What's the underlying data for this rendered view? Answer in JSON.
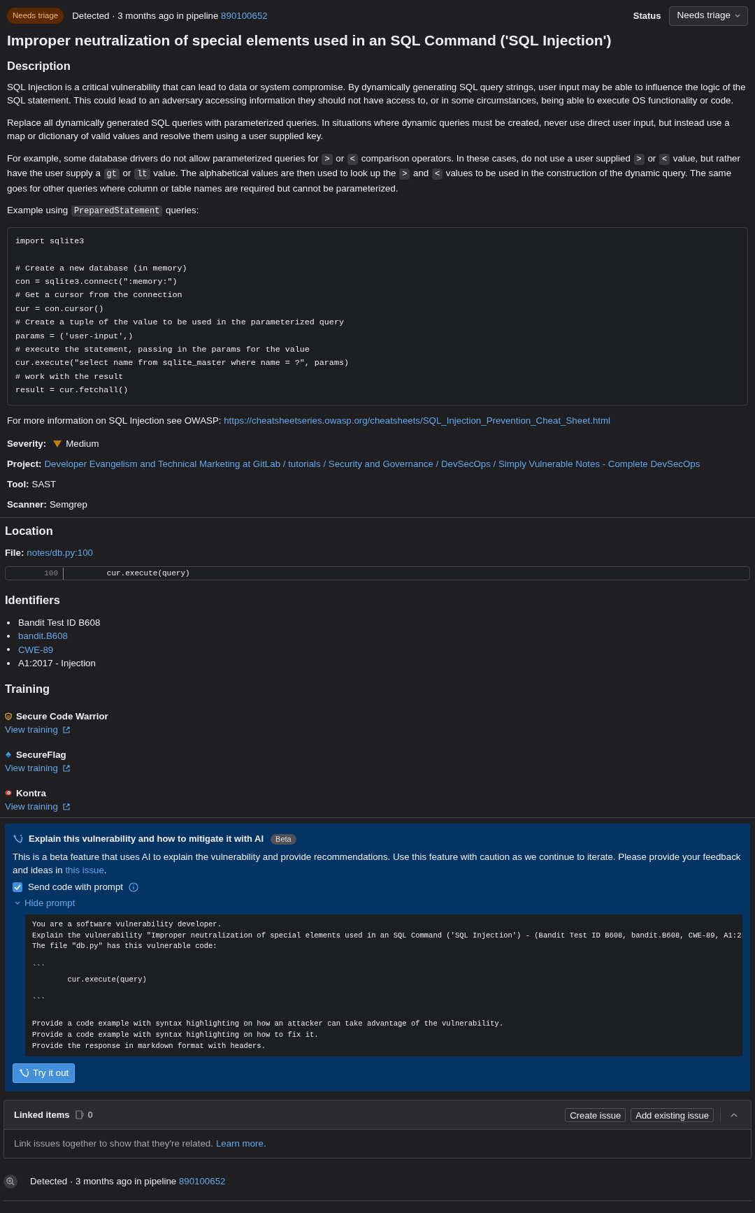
{
  "header": {
    "badge": "Needs triage",
    "detected": "Detected · 3 months ago in pipeline",
    "pipeline": "890100652",
    "status_label": "Status",
    "status_value": "Needs triage"
  },
  "title": "Improper neutralization of special elements used in an SQL Command ('SQL Injection')",
  "description": {
    "heading": "Description",
    "paragraphs": [
      [
        {
          "kind": "text",
          "text": "SQL Injection is a critical vulnerability that can lead to data or system compromise. By dynamically generating SQL query strings, user input may be able to influence the logic of the SQL statement. This could lead to an adversary accessing information they should not have access to, or in some circumstances, being able to execute OS functionality or code."
        }
      ],
      [
        {
          "kind": "text",
          "text": "Replace all dynamically generated SQL queries with parameterized queries. In situations where dynamic queries must be created, never use direct user input, but instead use a map or dictionary of valid values and resolve them using a user supplied key."
        }
      ],
      [
        {
          "kind": "text",
          "text": "For example, some database drivers do not allow parameterized queries for "
        },
        {
          "kind": "code",
          "text": ">"
        },
        {
          "kind": "text",
          "text": " or "
        },
        {
          "kind": "code",
          "text": "<"
        },
        {
          "kind": "text",
          "text": " comparison operators. In these cases, do not use a user supplied "
        },
        {
          "kind": "code",
          "text": ">"
        },
        {
          "kind": "text",
          "text": " or "
        },
        {
          "kind": "code",
          "text": "<"
        },
        {
          "kind": "text",
          "text": " value, but rather have the user supply a "
        },
        {
          "kind": "code",
          "text": "gt"
        },
        {
          "kind": "text",
          "text": " or "
        },
        {
          "kind": "code",
          "text": "lt"
        },
        {
          "kind": "text",
          "text": " value. The alphabetical values are then used to look up the "
        },
        {
          "kind": "code",
          "text": ">"
        },
        {
          "kind": "text",
          "text": " and "
        },
        {
          "kind": "code",
          "text": "<"
        },
        {
          "kind": "text",
          "text": " values to be used in the construction of the dynamic query. The same goes for other queries where column or table names are required but cannot be parameterized."
        }
      ],
      [
        {
          "kind": "text",
          "text": "Example using "
        },
        {
          "kind": "code",
          "text": "PreparedStatement"
        },
        {
          "kind": "text",
          "text": " queries:"
        }
      ]
    ],
    "code": "import sqlite3\n\n# Create a new database (in memory)\ncon = sqlite3.connect(\":memory:\")\n# Get a cursor from the connection\ncur = con.cursor()\n# Create a tuple of the value to be used in the parameterized query\nparams = ('user-input',)\n# execute the statement, passing in the params for the value\ncur.execute(\"select name from sqlite_master where name = ?\", params)\n# work with the result\nresult = cur.fetchall()",
    "more_info": [
      {
        "kind": "text",
        "text": "For more information on SQL Injection see OWASP: "
      },
      {
        "kind": "link",
        "text": "https://cheatsheetseries.owasp.org/cheatsheets/SQL_Injection_Prevention_Cheat_Sheet.html"
      }
    ]
  },
  "details": [
    {
      "label": "Severity:",
      "value": "Medium",
      "kind": "severity"
    },
    {
      "label": "Project:",
      "value": "Developer Evangelism and Technical Marketing at GitLab / tutorials / Security and Governance / DevSecOps / Simply Vulnerable Notes - Complete DevSecOps",
      "kind": "link"
    },
    {
      "label": "Tool:",
      "value": "SAST",
      "kind": "text"
    },
    {
      "label": "Scanner:",
      "value": "Semgrep",
      "kind": "text"
    }
  ],
  "location": {
    "heading": "Location",
    "file_label": "File:",
    "file_link": "notes/db.py:100",
    "line_number": "100",
    "line_code": "        cur.execute(query)"
  },
  "identifiers": {
    "heading": "Identifiers",
    "items": [
      {
        "kind": "text",
        "text": "Bandit Test ID B608"
      },
      {
        "kind": "link",
        "text": "bandit.B608"
      },
      {
        "kind": "link",
        "text": "CWE-89"
      },
      {
        "kind": "text",
        "text": "A1:2017 - Injection"
      }
    ]
  },
  "training": {
    "heading": "Training",
    "providers": [
      {
        "kind": "shield",
        "name": "Secure Code Warrior",
        "link": "View training"
      },
      {
        "kind": "flag",
        "name": "SecureFlag",
        "link": "View training"
      },
      {
        "kind": "eye",
        "name": "Kontra",
        "link": "View training"
      }
    ]
  },
  "ai": {
    "title": "Explain this vulnerability and how to mitigate it with AI",
    "badge": "Beta",
    "description": [
      {
        "kind": "text",
        "text": "This is a beta feature that uses AI to explain the vulnerability and provide recommendations. Use this feature with caution as we continue to iterate. Please provide your feedback and ideas in "
      },
      {
        "kind": "link",
        "text": "this issue"
      },
      {
        "kind": "text",
        "text": "."
      }
    ],
    "send_code": {
      "label": "Send code with prompt",
      "checked": true
    },
    "prompt_toggle": {
      "label": "Hide prompt",
      "expanded": true
    },
    "prompt": "You are a software vulnerability developer.\nExplain the vulnerability \"Improper neutralization of special elements used in an SQL Command ('SQL Injection') - (Bandit Test ID B608, bandit.B608, CWE-89, A1:2\nThe file \"db.py\" has this vulnerable code:\n\n```\n        cur.execute(query)\n\n```\n\nProvide a code example with syntax highlighting on how an attacker can take advantage of the vulnerability.\nProvide a code example with syntax highlighting on how to fix it.\nProvide the response in markdown format with headers.",
    "button": "Try it out"
  },
  "linked_items": {
    "title": "Linked items",
    "count": "0",
    "buttons": [
      "Create issue",
      "Add existing issue"
    ],
    "expanded": true,
    "body": [
      {
        "kind": "text",
        "text": "Link issues together to show that they're related. "
      },
      {
        "kind": "link",
        "text": "Learn more."
      }
    ]
  },
  "footer": {
    "detected": "Detected · 3 months ago in pipeline",
    "pipeline": "890100652"
  }
}
